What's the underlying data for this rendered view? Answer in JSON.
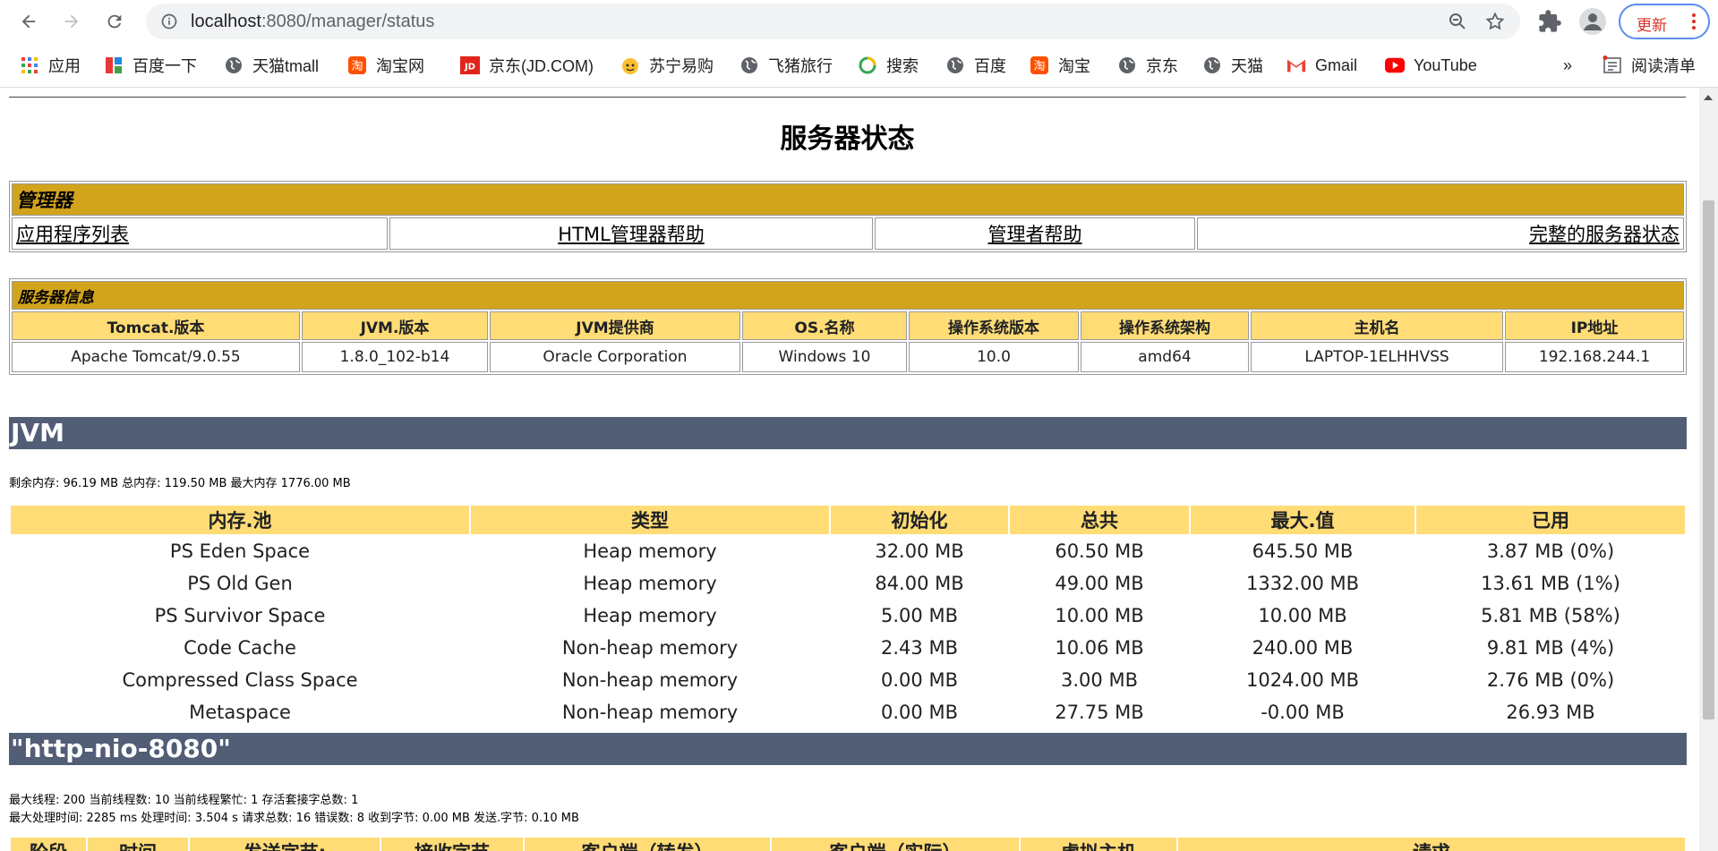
{
  "browser": {
    "url_host": "localhost",
    "url_path": ":8080/manager/status",
    "update_label": "更新"
  },
  "bookmarks": [
    {
      "label": "应用",
      "icon": "apps-grid-icon"
    },
    {
      "label": "百度一下",
      "icon": "baidu-icon"
    },
    {
      "label": "天猫tmall",
      "icon": "globe-icon"
    },
    {
      "label": "淘宝网",
      "icon": "taobao-icon"
    },
    {
      "label": "京东(JD.COM)",
      "icon": "jd-icon"
    },
    {
      "label": "苏宁易购",
      "icon": "suning-icon"
    },
    {
      "label": "飞猪旅行",
      "icon": "globe-icon"
    },
    {
      "label": "搜索",
      "icon": "search-360-icon"
    },
    {
      "label": "百度",
      "icon": "globe-icon"
    },
    {
      "label": "淘宝",
      "icon": "taobao-icon"
    },
    {
      "label": "京东",
      "icon": "globe-icon"
    },
    {
      "label": "天猫",
      "icon": "globe-icon"
    },
    {
      "label": "Gmail",
      "icon": "gmail-icon"
    },
    {
      "label": "YouTube",
      "icon": "youtube-icon"
    }
  ],
  "bookmarks_more": "»",
  "reading_list": "阅读清单",
  "page": {
    "title": "服务器状态",
    "manager": {
      "header": "管理器",
      "links": [
        "应用程序列表",
        "HTML管理器帮助",
        "管理者帮助",
        "完整的服务器状态"
      ]
    },
    "server_info": {
      "header": "服务器信息",
      "columns": [
        "Tomcat.版本",
        "JVM.版本",
        "JVM提供商",
        "OS.名称",
        "操作系统版本",
        "操作系统架构",
        "主机名",
        "IP地址"
      ],
      "values": [
        "Apache Tomcat/9.0.55",
        "1.8.0_102-b14",
        "Oracle Corporation",
        "Windows 10",
        "10.0",
        "amd64",
        "LAPTOP-1ELHHVSS",
        "192.168.244.1"
      ]
    },
    "jvm": {
      "title": "JVM",
      "memory_line": "剩余内存:  96.19 MB 总内存:  119.50 MB 最大内存 1776.00 MB",
      "columns": [
        "内存.池",
        "类型",
        "初始化",
        "总共",
        "最大.值",
        "已用"
      ],
      "rows": [
        [
          "PS Eden Space",
          "Heap memory",
          "32.00 MB",
          "60.50 MB",
          "645.50 MB",
          "3.87 MB (0%)"
        ],
        [
          "PS Old Gen",
          "Heap memory",
          "84.00 MB",
          "49.00 MB",
          "1332.00 MB",
          "13.61 MB (1%)"
        ],
        [
          "PS Survivor Space",
          "Heap memory",
          "5.00 MB",
          "10.00 MB",
          "10.00 MB",
          "5.81 MB (58%)"
        ],
        [
          "Code Cache",
          "Non-heap memory",
          "2.43 MB",
          "10.06 MB",
          "240.00 MB",
          "9.81 MB (4%)"
        ],
        [
          "Compressed Class Space",
          "Non-heap memory",
          "0.00 MB",
          "3.00 MB",
          "1024.00 MB",
          "2.76 MB (0%)"
        ],
        [
          "Metaspace",
          "Non-heap memory",
          "0.00 MB",
          "27.75 MB",
          "-0.00 MB",
          "26.93 MB"
        ]
      ]
    },
    "connector": {
      "title": "\"http-nio-8080\"",
      "line1": "最大线程:  200 当前线程数:  10 当前线程繁忙:  1 存活套接字总数:  1",
      "line2": "最大处理时间:  2285 ms 处理时间:  3.504 s 请求总数:  16 错误数:  8 收到字节:  0.00 MB 发送.字节: 0.10 MB",
      "columns": [
        "阶段",
        "时间",
        "发送字节:",
        "接收字节",
        "客户端（转发）",
        "客户端（实际）",
        "虚拟主机",
        "请求"
      ]
    }
  },
  "colors": {
    "section_header": "#D2A41C",
    "table_header": "#FFDC75",
    "band": "#525D76"
  }
}
